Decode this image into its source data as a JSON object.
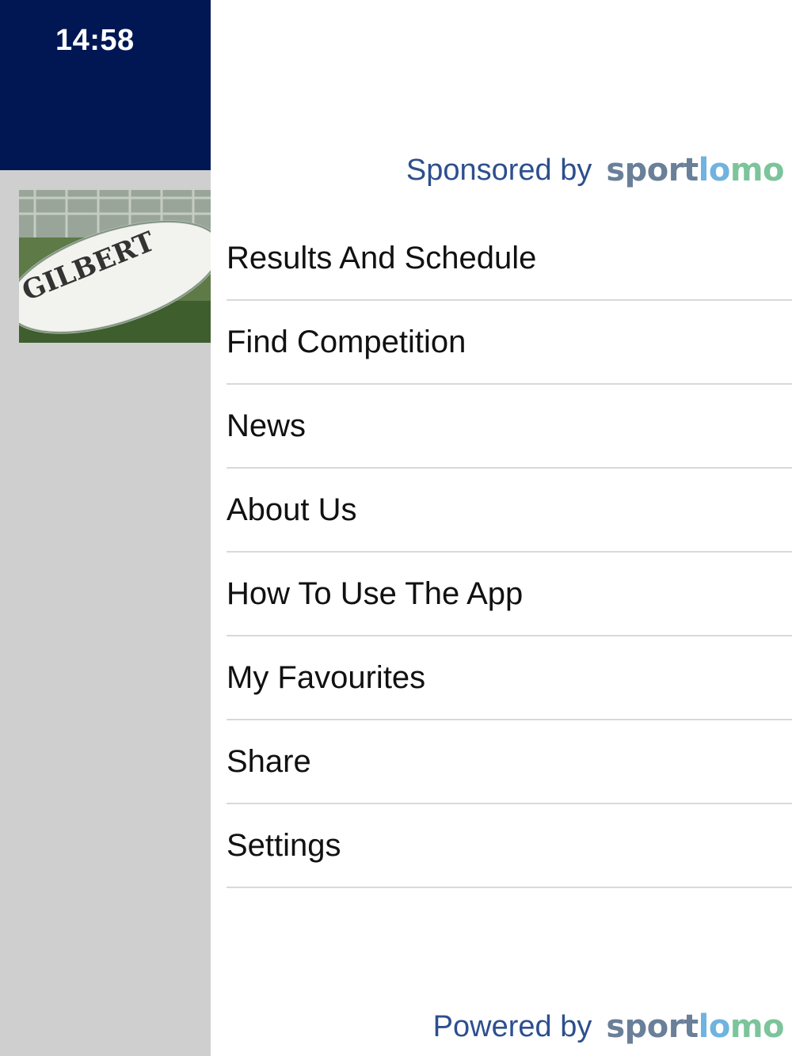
{
  "status_bar": {
    "time": "14:58"
  },
  "sponsor": {
    "label": "Sponsored by",
    "logo_parts": [
      "sport",
      "lo",
      "mo"
    ]
  },
  "menu": {
    "items": [
      {
        "label": "Results And Schedule"
      },
      {
        "label": "Find Competition"
      },
      {
        "label": "News"
      },
      {
        "label": "About Us"
      },
      {
        "label": "How To Use The App"
      },
      {
        "label": "My Favourites"
      },
      {
        "label": "Share"
      },
      {
        "label": "Settings"
      }
    ]
  },
  "footer": {
    "label": "Powered by",
    "logo_parts": [
      "sport",
      "lo",
      "mo"
    ]
  },
  "colors": {
    "header_navy": "#001753",
    "sponsor_text": "#2d4f8e",
    "logo_grey": "#6a7f98",
    "logo_blue": "#6fb3e0",
    "logo_green": "#7cc49b",
    "divider": "#d9d9d9"
  },
  "images": {
    "news_thumbnail": "rugby-ball-photo"
  }
}
